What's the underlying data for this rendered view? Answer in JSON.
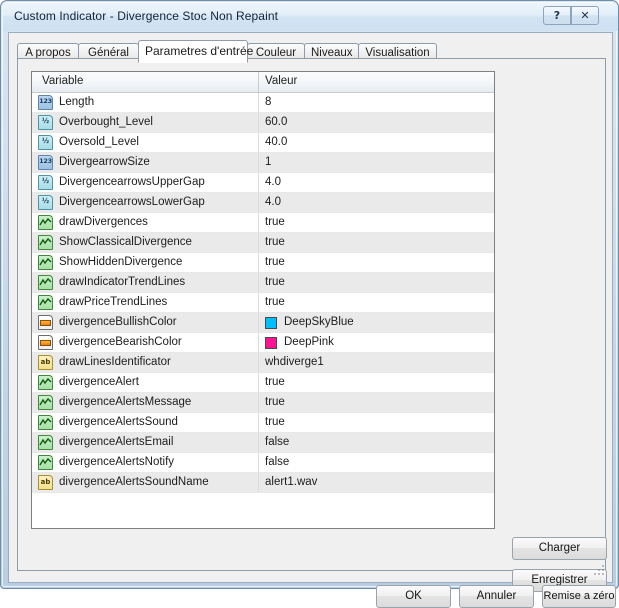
{
  "window": {
    "title": "Custom Indicator - Divergence Stoc Non Repaint",
    "help_glyph": "?",
    "close_glyph": "✕"
  },
  "tabs": [
    {
      "label": "A propos",
      "selected": false
    },
    {
      "label": "Général",
      "selected": false
    },
    {
      "label": "Parametres d'entrée",
      "selected": true
    },
    {
      "label": "Couleur",
      "selected": false
    },
    {
      "label": "Niveaux",
      "selected": false
    },
    {
      "label": "Visualisation",
      "selected": false
    }
  ],
  "table": {
    "columns": [
      "Variable",
      "Valeur"
    ],
    "rows": [
      {
        "icon": "integer-type-icon",
        "type": "int",
        "name": "Length",
        "value": "8"
      },
      {
        "icon": "double-type-icon",
        "type": "double",
        "name": "Overbought_Level",
        "value": "60.0"
      },
      {
        "icon": "double-type-icon",
        "type": "double",
        "name": "Oversold_Level",
        "value": "40.0"
      },
      {
        "icon": "integer-type-icon",
        "type": "int",
        "name": "DivergearrowSize",
        "value": "1"
      },
      {
        "icon": "double-type-icon",
        "type": "double",
        "name": "DivergencearrowsUpperGap",
        "value": "4.0"
      },
      {
        "icon": "double-type-icon",
        "type": "double",
        "name": "DivergencearrowsLowerGap",
        "value": "4.0"
      },
      {
        "icon": "boolean-type-icon",
        "type": "bool",
        "name": "drawDivergences",
        "value": "true"
      },
      {
        "icon": "boolean-type-icon",
        "type": "bool",
        "name": "ShowClassicalDivergence",
        "value": "true"
      },
      {
        "icon": "boolean-type-icon",
        "type": "bool",
        "name": "ShowHiddenDivergence",
        "value": "true"
      },
      {
        "icon": "boolean-type-icon",
        "type": "bool",
        "name": "drawIndicatorTrendLines",
        "value": "true"
      },
      {
        "icon": "boolean-type-icon",
        "type": "bool",
        "name": "drawPriceTrendLines",
        "value": "true"
      },
      {
        "icon": "color-type-icon",
        "type": "color",
        "name": "divergenceBullishColor",
        "value": "DeepSkyBlue",
        "swatch": "#00BFFF"
      },
      {
        "icon": "color-type-icon",
        "type": "color",
        "name": "divergenceBearishColor",
        "value": "DeepPink",
        "swatch": "#FF1493"
      },
      {
        "icon": "string-type-icon",
        "type": "string",
        "name": "drawLinesIdentificator",
        "value": "whdiverge1"
      },
      {
        "icon": "boolean-type-icon",
        "type": "bool",
        "name": "divergenceAlert",
        "value": "true"
      },
      {
        "icon": "boolean-type-icon",
        "type": "bool",
        "name": "divergenceAlertsMessage",
        "value": "true"
      },
      {
        "icon": "boolean-type-icon",
        "type": "bool",
        "name": "divergenceAlertsSound",
        "value": "true"
      },
      {
        "icon": "boolean-type-icon",
        "type": "bool",
        "name": "divergenceAlertsEmail",
        "value": "false"
      },
      {
        "icon": "boolean-type-icon",
        "type": "bool",
        "name": "divergenceAlertsNotify",
        "value": "false"
      },
      {
        "icon": "string-type-icon",
        "type": "string",
        "name": "divergenceAlertsSoundName",
        "value": "alert1.wav"
      }
    ]
  },
  "side_buttons": {
    "load": "Charger",
    "save": "Enregistrer"
  },
  "footer_buttons": {
    "ok": "OK",
    "cancel": "Annuler",
    "reset": "Remise a zéro"
  }
}
